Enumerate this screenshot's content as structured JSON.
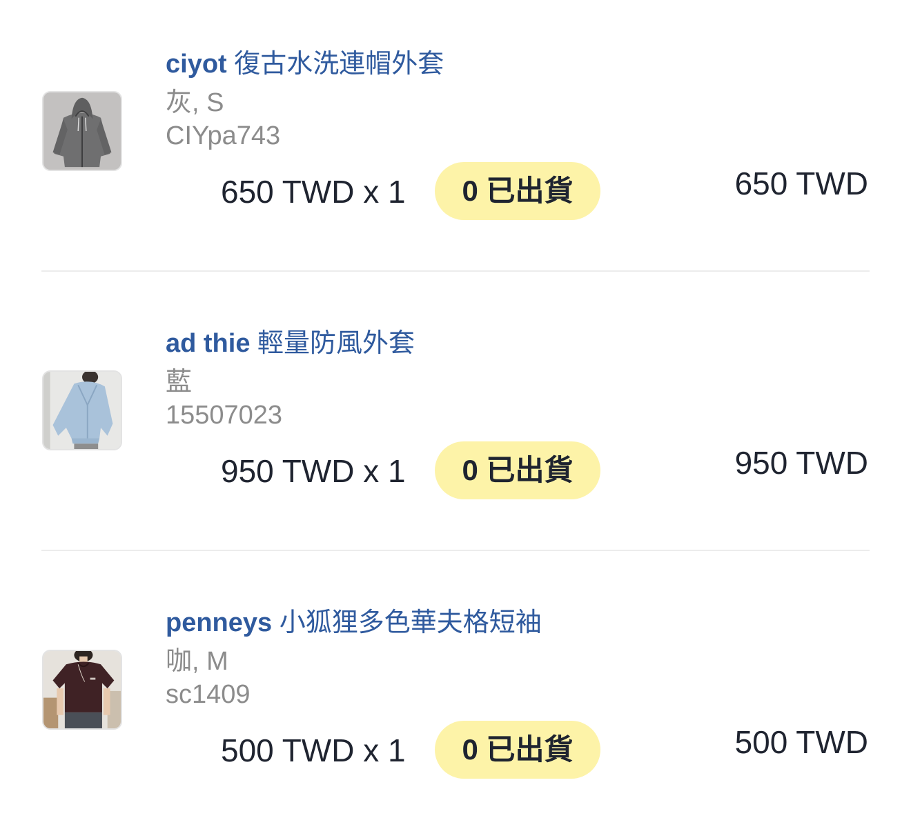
{
  "orders": [
    {
      "brand": "ciyot",
      "name": "復古水洗連帽外套",
      "variant": "灰, S",
      "sku": "CIYpa743",
      "unit_price": "650 TWD x 1",
      "status": "0 已出貨",
      "subtotal": "650 TWD",
      "thumbnail_icon": "gray-hoodie-jacket-photo"
    },
    {
      "brand": "ad thie",
      "name": "輕量防風外套",
      "variant": "藍",
      "sku": "15507023",
      "unit_price": "950 TWD x 1",
      "status": "0 已出貨",
      "subtotal": "950 TWD",
      "thumbnail_icon": "light-blue-windbreaker-photo"
    },
    {
      "brand": "penneys",
      "name": "小狐狸多色華夫格短袖",
      "variant": "咖, M",
      "sku": "sc1409",
      "unit_price": "500 TWD x 1",
      "status": "0 已出貨",
      "subtotal": "500 TWD",
      "thumbnail_icon": "brown-tshirt-photo"
    }
  ],
  "colors": {
    "title": "#2f5a9e",
    "muted_text": "#8c8c8c",
    "price_text": "#1f2430",
    "status_badge_bg": "#fdf3a8",
    "divider": "#ececec"
  }
}
